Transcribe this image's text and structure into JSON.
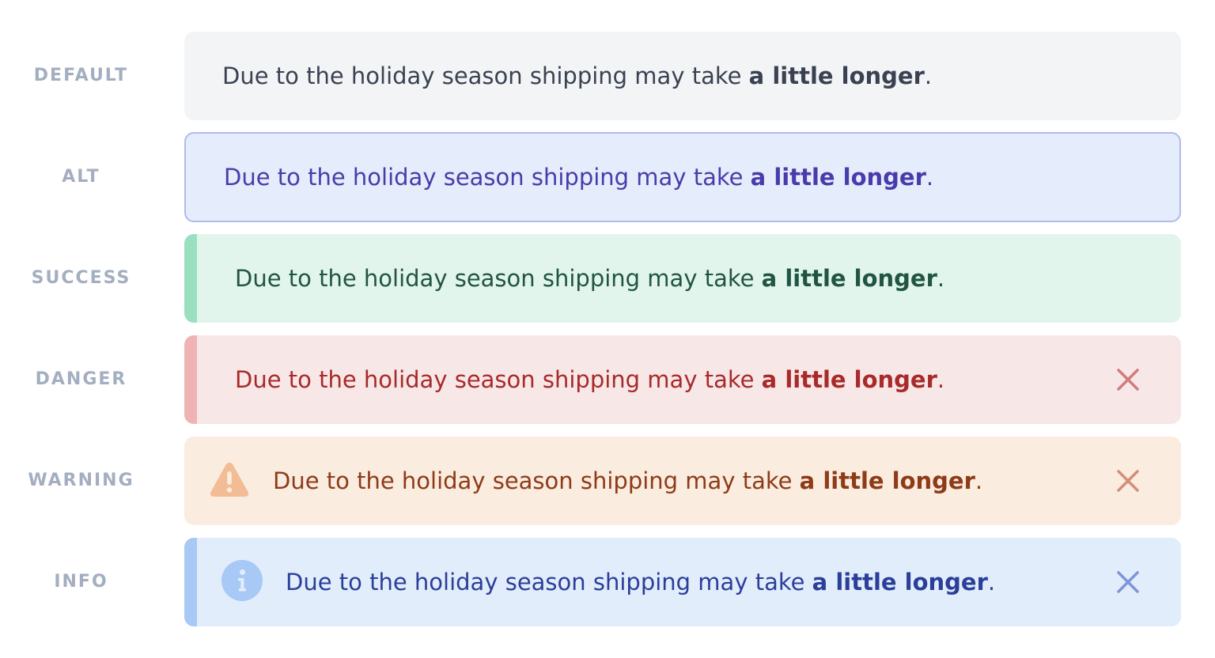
{
  "colors": {
    "default_bg": "#f3f4f6",
    "default_text": "#3a4252",
    "alt_bg": "#e5ecfb",
    "alt_border": "#aebcef",
    "alt_text": "#4a3bab",
    "success_bg": "#e2f5ed",
    "success_accent": "#9adfbf",
    "success_text": "#215543",
    "danger_bg": "#f8e7e7",
    "danger_accent": "#efb3b3",
    "danger_text": "#a82a2a",
    "warning_bg": "#faecdf",
    "warning_icon": "#f2bc94",
    "warning_text": "#8e3b18",
    "info_bg": "#e1edfb",
    "info_accent": "#a8c8f5",
    "info_text": "#2b3e9a",
    "label_text": "#a3aec0"
  },
  "alerts": [
    {
      "label": "DEFAULT",
      "message": "Due to the holiday season shipping may take ",
      "emphasis": "a little longer",
      "tail": "."
    },
    {
      "label": "ALT",
      "message": "Due to the holiday season shipping may take ",
      "emphasis": "a little longer",
      "tail": "."
    },
    {
      "label": "SUCCESS",
      "message": "Due to the holiday season shipping may take ",
      "emphasis": "a little longer",
      "tail": "."
    },
    {
      "label": "DANGER",
      "message": "Due to the holiday season shipping may take ",
      "emphasis": "a little longer",
      "tail": ".",
      "close_icon": "close-icon"
    },
    {
      "label": "WARNING",
      "message": "Due to the holiday season shipping may take ",
      "emphasis": "a little longer",
      "tail": ".",
      "lead_icon": "warning-triangle-icon",
      "close_icon": "close-icon"
    },
    {
      "label": "INFO",
      "message": "Due to the holiday season shipping may take ",
      "emphasis": "a little longer",
      "tail": ".",
      "lead_icon": "info-circle-icon",
      "close_icon": "close-icon"
    }
  ]
}
